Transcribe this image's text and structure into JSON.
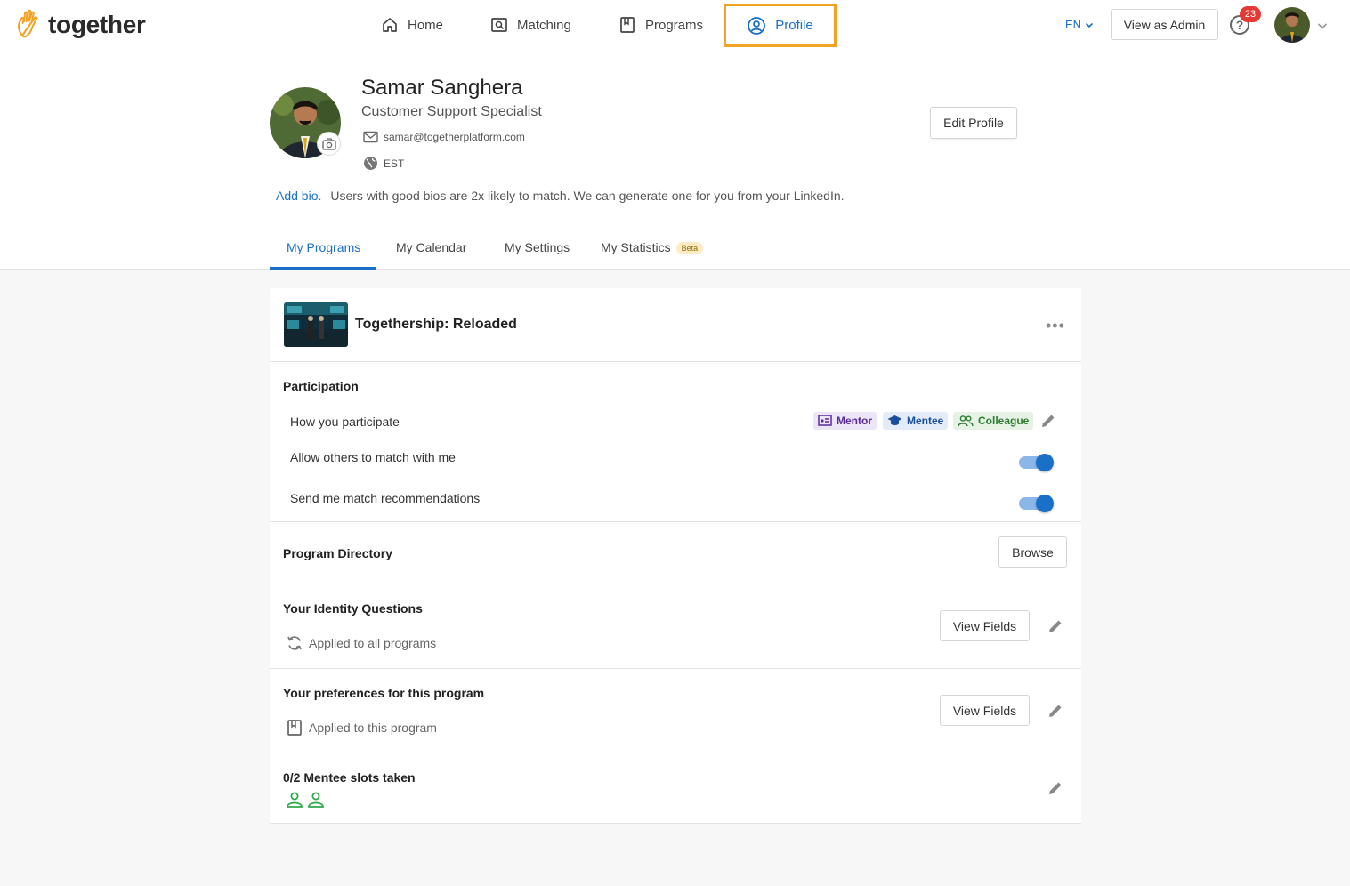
{
  "header": {
    "logo_text": "together",
    "nav": [
      {
        "label": "Home",
        "icon": "home-icon"
      },
      {
        "label": "Matching",
        "icon": "matching-icon"
      },
      {
        "label": "Programs",
        "icon": "book-icon"
      },
      {
        "label": "Profile",
        "icon": "user-circle-icon"
      }
    ],
    "language": "EN",
    "view_as_admin": "View as Admin",
    "help_icon_label": "?",
    "notification_count": "23"
  },
  "profile": {
    "name": "Samar Sanghera",
    "title": "Customer Support Specialist",
    "email": "samar@togetherplatform.com",
    "timezone": "EST",
    "edit_profile": "Edit Profile",
    "add_bio": "Add bio.",
    "bio_hint": "Users with good bios are 2x likely to match. We can generate one for you from your LinkedIn."
  },
  "tabs": [
    {
      "label": "My Programs"
    },
    {
      "label": "My Calendar"
    },
    {
      "label": "My Settings"
    },
    {
      "label": "My Statistics",
      "badge": "Beta"
    }
  ],
  "program": {
    "name": "Togethership: Reloaded",
    "more_label": "•••",
    "participation": {
      "heading": "Participation",
      "how_label": "How you participate",
      "roles": [
        {
          "label": "Mentor",
          "color": "#5b2a9a",
          "bg": "#ece4f7"
        },
        {
          "label": "Mentee",
          "color": "#1a4fa0",
          "bg": "#e3ecf8"
        },
        {
          "label": "Colleague",
          "color": "#2e7d32",
          "bg": "#e6f2e6"
        }
      ],
      "allow_match": "Allow others to match with me",
      "recommendations": "Send me match recommendations"
    },
    "directory": {
      "heading": "Program Directory",
      "button": "Browse"
    },
    "identity": {
      "heading": "Your Identity Questions",
      "button": "View Fields",
      "sub": "Applied to all programs"
    },
    "preferences": {
      "heading": "Your preferences for this program",
      "button": "View Fields",
      "sub": "Applied to this program"
    },
    "slots": {
      "heading": "0/2 Mentee slots taken",
      "total": 2,
      "taken": 0
    }
  },
  "colors": {
    "accent": "#1a6fc9",
    "highlight": "#f0a224",
    "slot_green": "#2eaa4a"
  }
}
